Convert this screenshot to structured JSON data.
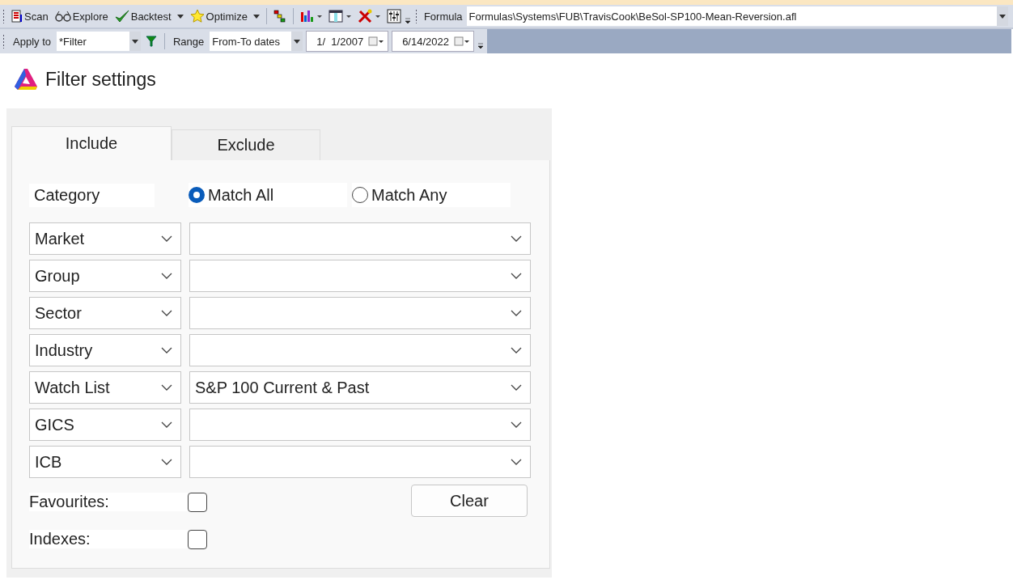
{
  "toolbar": {
    "buttons": [
      {
        "label": "Scan",
        "dropdown": false
      },
      {
        "label": "Explore",
        "dropdown": false
      },
      {
        "label": "Backtest",
        "dropdown": true
      },
      {
        "label": "Optimize",
        "dropdown": true
      }
    ],
    "formula_label": "Formula",
    "formula": "Formulas\\Systems\\FUB\\TravisCook\\BeSol-SP100-Mean-Reversion.afl"
  },
  "range_bar": {
    "apply_label": "Apply to",
    "apply_value": "*Filter",
    "range_label": "Range",
    "range_value": "From-To dates",
    "from_date": "1/  1/2007",
    "to_date": "6/14/2022"
  },
  "title": "Filter settings",
  "tabs": [
    {
      "label": "Include",
      "selected": true
    },
    {
      "label": "Exclude",
      "selected": false
    }
  ],
  "category_label": "Category",
  "match_options": [
    {
      "label": "Match All",
      "selected": true
    },
    {
      "label": "Match Any",
      "selected": false
    }
  ],
  "filters": [
    {
      "field": "Market"
    },
    {
      "field": "Group"
    },
    {
      "field": "Sector"
    },
    {
      "field": "Industry"
    },
    {
      "field": "Watch List",
      "value": "S&P 100 Current & Past"
    },
    {
      "field": "GICS"
    },
    {
      "field": "ICB"
    }
  ],
  "checkboxes": [
    {
      "label": "Favourites:",
      "checked": false
    },
    {
      "label": "Indexes:",
      "checked": false
    }
  ],
  "clear_button": "Clear"
}
